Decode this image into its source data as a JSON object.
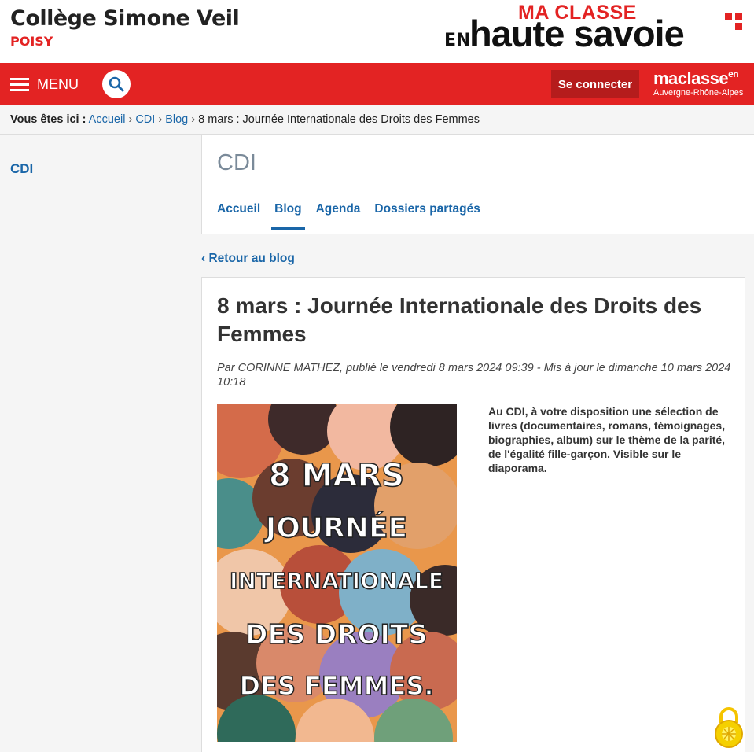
{
  "header": {
    "school_name": "Collège Simone Veil",
    "school_city": "POISY",
    "logo": {
      "ma_classe": "MA  CLASSE",
      "en": "EN",
      "main": "haute savoie"
    }
  },
  "navbar": {
    "menu_label": "MENU",
    "search_icon": "search-icon",
    "login_label": "Se connecter",
    "partner_logo": {
      "main": "maclasse",
      "sup": "en",
      "region": "Auvergne-Rhône-Alpes"
    }
  },
  "breadcrumb": {
    "prefix": "Vous êtes ici :",
    "items": [
      "Accueil",
      "CDI",
      "Blog"
    ],
    "current": "8 mars : Journée Internationale des Droits des Femmes",
    "separator": "›"
  },
  "sidebar": {
    "title": "CDI"
  },
  "section": {
    "title": "CDI",
    "tabs": [
      {
        "label": "Accueil",
        "active": false
      },
      {
        "label": "Blog",
        "active": true
      },
      {
        "label": "Agenda",
        "active": false
      },
      {
        "label": "Dossiers partagés",
        "active": false
      }
    ]
  },
  "back_link": "‹ Retour au blog",
  "article": {
    "title": "8 mars : Journée Internationale des Droits des Femmes",
    "meta": "Par CORINNE MATHEZ, publié le vendredi 8 mars 2024 09:39 - Mis à jour le dimanche 10 mars 2024 10:18",
    "poster_lines": [
      "8 MARS",
      "JOURNÉE",
      "INTERNATIONALE",
      "DES DROITS",
      "DES FEMMES."
    ],
    "body": "Au CDI, à votre disposition une sélection de livres (documentaires, romans, témoignages, biographies, album) sur le thème de la parité, de l'égalité fille-garçon. Visible sur le diaporama."
  },
  "colors": {
    "brand_red": "#e32323",
    "link_blue": "#1a66a8",
    "login_dark_red": "#b51c1c"
  }
}
